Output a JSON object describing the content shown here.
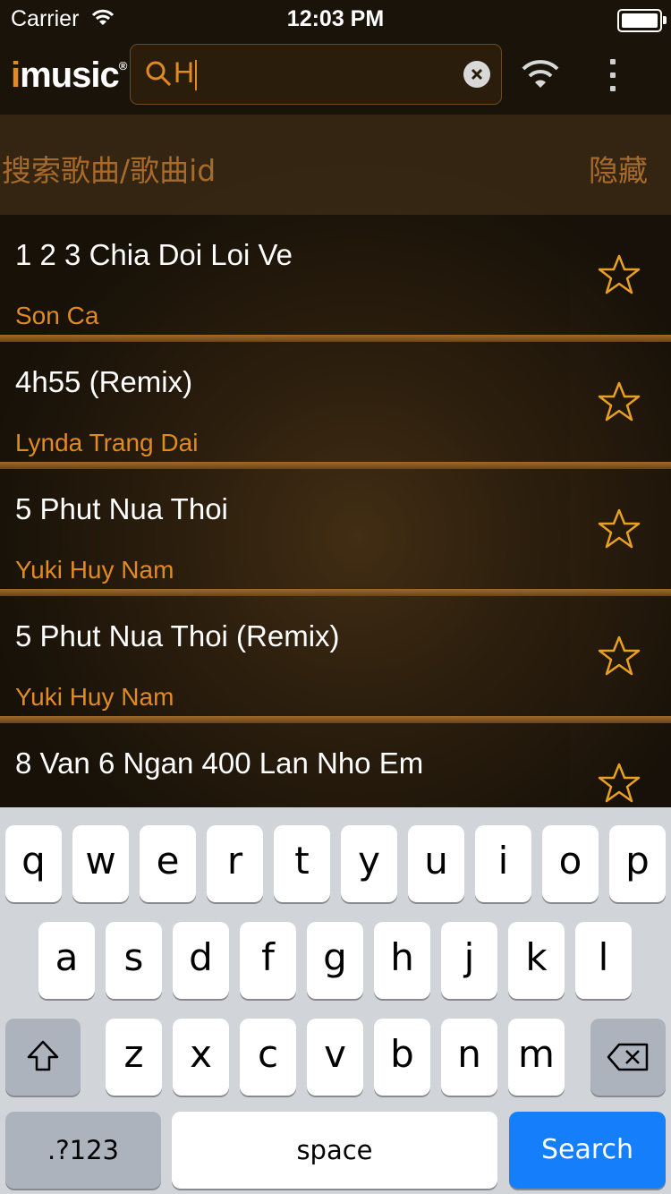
{
  "status_bar": {
    "carrier": "Carrier",
    "time": "12:03 PM"
  },
  "header": {
    "logo_i": "i",
    "logo_rest": "music",
    "logo_reg": "®",
    "search_value": "H"
  },
  "hint_bar": {
    "hint": "搜索歌曲/歌曲id",
    "hide": "隐藏"
  },
  "songs": [
    {
      "title": "1 2 3 Chia Doi Loi Ve",
      "artist": "Son Ca"
    },
    {
      "title": "4h55 (Remix)",
      "artist": "Lynda Trang Dai"
    },
    {
      "title": "5 Phut Nua Thoi",
      "artist": "Yuki Huy Nam"
    },
    {
      "title": "5 Phut Nua Thoi (Remix)",
      "artist": "Yuki Huy Nam"
    },
    {
      "title": "8 Van 6 Ngan 400 Lan Nho Em",
      "artist": ""
    }
  ],
  "keyboard": {
    "row1": [
      "q",
      "w",
      "e",
      "r",
      "t",
      "y",
      "u",
      "i",
      "o",
      "p"
    ],
    "row2": [
      "a",
      "s",
      "d",
      "f",
      "g",
      "h",
      "j",
      "k",
      "l"
    ],
    "row3": [
      "z",
      "x",
      "c",
      "v",
      "b",
      "n",
      "m"
    ],
    "numbers": ".?123",
    "space": "space",
    "search": "Search"
  },
  "colors": {
    "accent": "#e08a20",
    "keyboard_bg": "#d1d4d9",
    "search_key": "#147efb"
  }
}
